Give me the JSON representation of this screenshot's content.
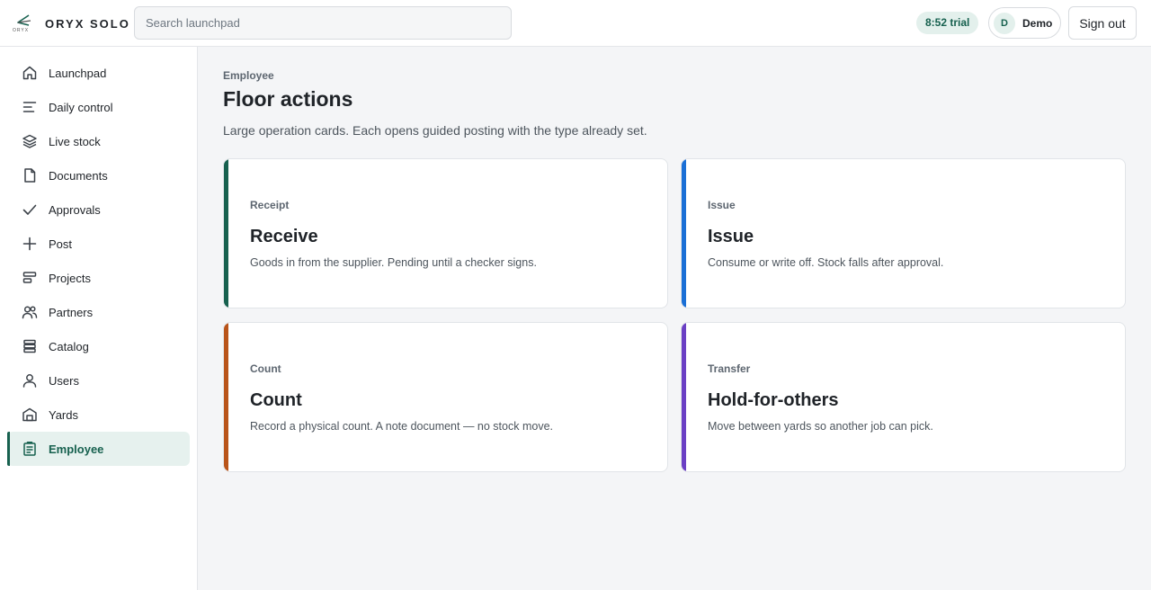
{
  "brand": {
    "name": "ORYX SOLO",
    "mark_text": "ORYX"
  },
  "search": {
    "placeholder": "Search launchpad",
    "value": ""
  },
  "header": {
    "trial": "8:52 trial",
    "user_initial": "D",
    "user_name": "Demo",
    "signout_label": "Sign out"
  },
  "sidebar": {
    "items": [
      {
        "label": "Launchpad",
        "icon": "home-icon"
      },
      {
        "label": "Daily control",
        "icon": "lines-icon"
      },
      {
        "label": "Live stock",
        "icon": "layers-icon"
      },
      {
        "label": "Documents",
        "icon": "file-icon"
      },
      {
        "label": "Approvals",
        "icon": "check-icon"
      },
      {
        "label": "Post",
        "icon": "plus-icon"
      },
      {
        "label": "Projects",
        "icon": "projects-icon"
      },
      {
        "label": "Partners",
        "icon": "users-icon"
      },
      {
        "label": "Catalog",
        "icon": "catalog-icon"
      },
      {
        "label": "Users",
        "icon": "user-icon"
      },
      {
        "label": "Yards",
        "icon": "warehouse-icon"
      },
      {
        "label": "Employee",
        "icon": "clipboard-icon",
        "active": true
      }
    ]
  },
  "main": {
    "eyebrow": "Employee",
    "title": "Floor actions",
    "subtitle": "Large operation cards. Each opens guided posting with the type already set.",
    "cards": [
      {
        "kind": "Receipt",
        "title": "Receive",
        "desc": "Goods in from the supplier. Pending until a checker signs.",
        "accent": "#17614f"
      },
      {
        "kind": "Issue",
        "title": "Issue",
        "desc": "Consume or write off. Stock falls after approval.",
        "accent": "#1a6fd6"
      },
      {
        "kind": "Count",
        "title": "Count",
        "desc": "Record a physical count. A note document — no stock move.",
        "accent": "#b9541a"
      },
      {
        "kind": "Transfer",
        "title": "Hold-for-others",
        "desc": "Move between yards so another job can pick.",
        "accent": "#6a3fc4"
      }
    ]
  }
}
